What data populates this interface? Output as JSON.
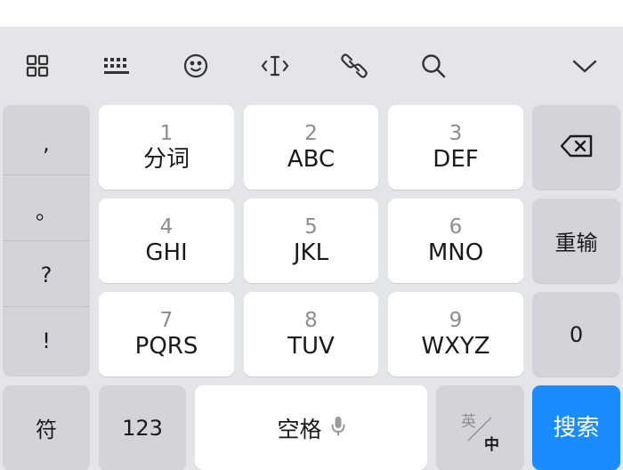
{
  "toolbar": {
    "icons": [
      "grid-icon",
      "keyboard-icon",
      "emoji-icon",
      "cursor-icon",
      "link-icon",
      "search-icon",
      "collapse-icon"
    ]
  },
  "punctuation": [
    ",",
    "。",
    "?",
    "!"
  ],
  "rows": [
    [
      {
        "num": "1",
        "label": "分词"
      },
      {
        "num": "2",
        "label": "ABC"
      },
      {
        "num": "3",
        "label": "DEF"
      }
    ],
    [
      {
        "num": "4",
        "label": "GHI"
      },
      {
        "num": "5",
        "label": "JKL"
      },
      {
        "num": "6",
        "label": "MNO"
      }
    ],
    [
      {
        "num": "7",
        "label": "PQRS"
      },
      {
        "num": "8",
        "label": "TUV"
      },
      {
        "num": "9",
        "label": "WXYZ"
      }
    ]
  ],
  "right_column": {
    "reinput": "重输",
    "zero": "0"
  },
  "bottom_row": {
    "symbol": "符",
    "numeric": "123",
    "space": "空格",
    "lang_en": "英",
    "lang_zh": "中",
    "search": "搜索"
  },
  "colors": {
    "background": "#e4e5e9",
    "key": "#ffffff",
    "function_key": "#d2d4d9",
    "accent": "#1a8cff"
  }
}
